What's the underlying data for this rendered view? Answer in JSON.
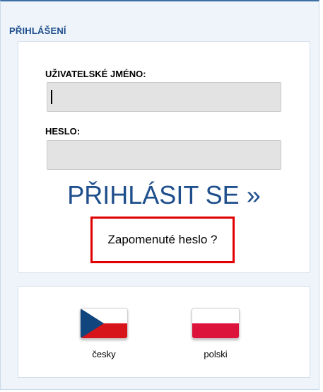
{
  "login": {
    "section_title": "PŘIHLÁŠENÍ",
    "username_label": "UŽIVATELSKÉ JMÉNO:",
    "username_value": "",
    "password_label": "HESLO:",
    "password_value": "",
    "submit_label": "PŘIHLÁSIT SE »",
    "forgot_password": "Zapomenuté heslo ?"
  },
  "languages": [
    {
      "label": "česky",
      "icon": "czech-flag-icon"
    },
    {
      "label": "polski",
      "icon": "polish-flag-icon"
    }
  ],
  "colors": {
    "accent": "#1e4e8c",
    "highlight_border": "#e00000",
    "input_bg": "#e3e3e3"
  }
}
